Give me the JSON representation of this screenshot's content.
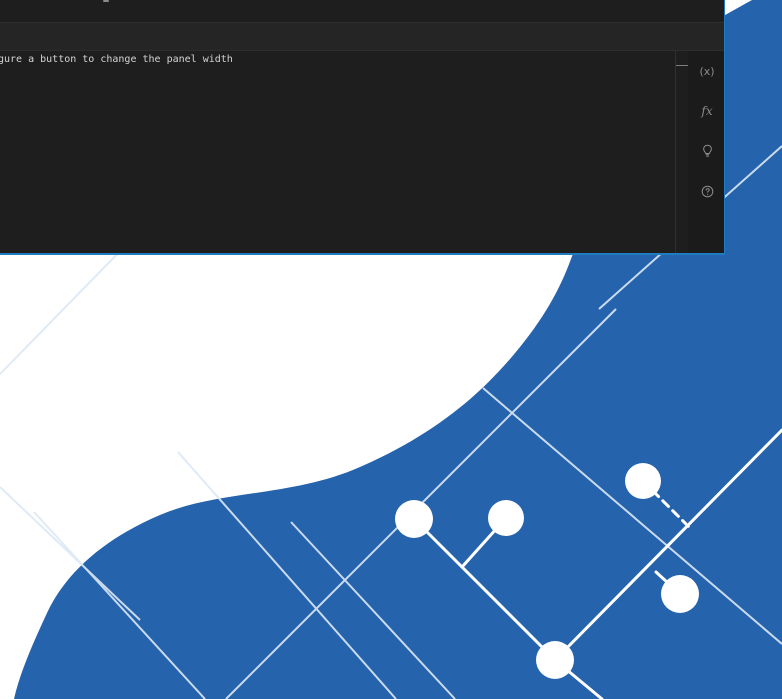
{
  "editor": {
    "code_text": "gure a button to change the panel width"
  },
  "sidebar_tools": {
    "variables_icon_text": "(x)",
    "functions_icon_text": "fx"
  },
  "icons": {
    "variables": "variables-icon",
    "functions": "function-icon",
    "hint": "lightbulb-icon",
    "help": "help-icon"
  },
  "colors": {
    "editor_bg": "#1e1e1e",
    "panel_header_bg": "#252526",
    "accent_border": "#1f7cc1",
    "background_blob": "#2563ad"
  }
}
